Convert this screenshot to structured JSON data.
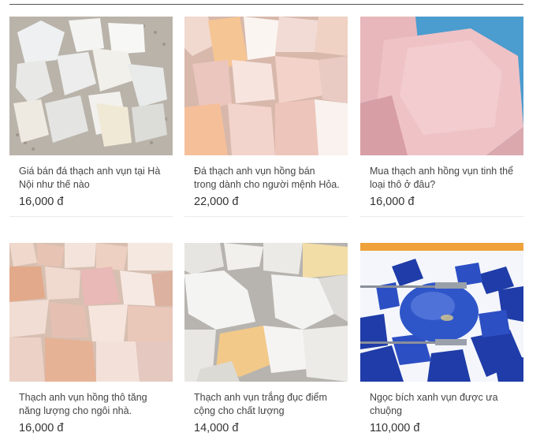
{
  "products": [
    {
      "title": "Giá bán đá thạch anh vụn tại Hà Nội như thế nào",
      "price": "16,000 đ",
      "image_icon": "white-quartz-chunks-image"
    },
    {
      "title": "Đá thạch anh vụn hồng bán trong dành cho người mệnh Hỏa.",
      "price": "22,000 đ",
      "image_icon": "pink-quartz-chunks-image"
    },
    {
      "title": "Mua thạch anh hồng vụn tinh thể loại thô ở đâu?",
      "price": "16,000 đ",
      "image_icon": "rose-quartz-rough-image"
    },
    {
      "title": "Thạch anh vụn hồng thô tăng năng lượng cho ngôi nhà.",
      "price": "16,000 đ",
      "image_icon": "pink-quartz-gravel-image"
    },
    {
      "title": "Thạch anh vụn trắng đục điểm cộng cho chất lượng",
      "price": "14,000 đ",
      "image_icon": "milky-white-quartz-image"
    },
    {
      "title": "Ngọc bích xanh vụn được ưa chuộng",
      "price": "110,000 đ",
      "image_icon": "blue-lapis-stones-image"
    }
  ],
  "colors": {
    "title_text": "#444444",
    "price_text": "#333333",
    "separator": "#e9e9e9"
  }
}
